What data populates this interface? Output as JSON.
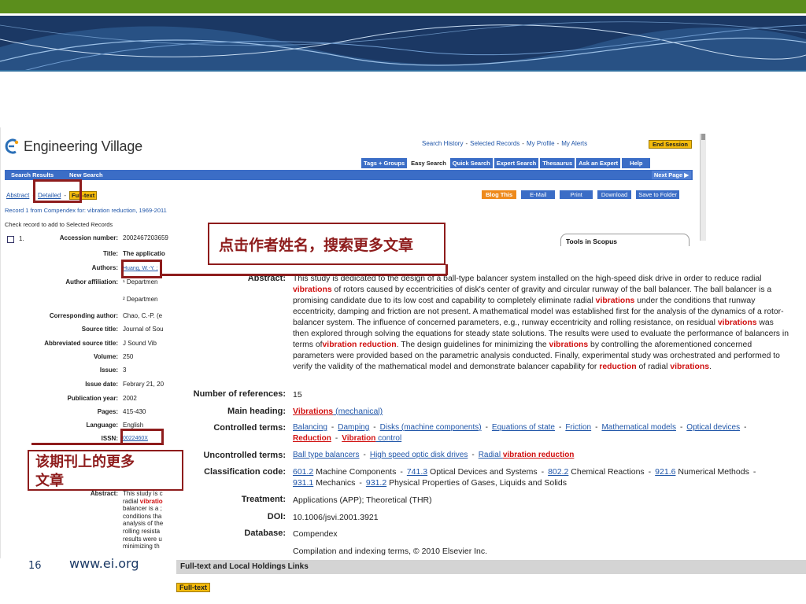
{
  "slide": {
    "page_number": "16",
    "site": "www.ei.org"
  },
  "annotations": {
    "author_tip": "点击作者姓名，搜索更多文章",
    "issn_tip_line1": "该期刊上的更多",
    "issn_tip_line2": "文章"
  },
  "app": {
    "logo_text": "Engineering Village",
    "top_links": [
      "Search History",
      "Selected Records",
      "My Profile",
      "My Alerts"
    ],
    "end_session": "End Session",
    "tabs": [
      "Tags + Groups",
      "Easy Search",
      "Quick Search",
      "Expert Search",
      "Thesaurus",
      "Ask an Expert",
      "Help"
    ],
    "active_tab": "Easy Search",
    "nav": {
      "search_results": "Search Results",
      "new_search": "New Search",
      "next_page": "Next Page ▶"
    },
    "subnav": {
      "abstract": "Abstract",
      "detailed": "Detailed",
      "fulltext": "Full-text"
    },
    "actions": [
      "Blog This",
      "E-Mail",
      "Print",
      "Download",
      "Save to Folder"
    ],
    "record_info": "Record 1 from Compendex for: vibration reduction, 1969-2011",
    "check_info": "Check record to add to Selected Records",
    "record_number": "1.",
    "tools_box": "Tools in Scopus"
  },
  "record_left": {
    "fields": [
      {
        "label": "Accession number:",
        "value": "2002467203659"
      },
      {
        "label": "Title:",
        "value": "The applicatio"
      },
      {
        "label": "Authors:",
        "value": "Huang, W.-Y. ;"
      },
      {
        "label": "Author affiliation:",
        "value": "¹ Departmen"
      },
      {
        "label": "",
        "value": "² Departmen"
      },
      {
        "label": "Corresponding author:",
        "value": "Chao, C.-P. (e"
      },
      {
        "label": "Source title:",
        "value": "Journal of Sou"
      },
      {
        "label": "Abbreviated source title:",
        "value": "J Sound Vib"
      },
      {
        "label": "Volume:",
        "value": "250"
      },
      {
        "label": "Issue:",
        "value": "3"
      },
      {
        "label": "Issue date:",
        "value": "Febrary 21, 20"
      },
      {
        "label": "Publication year:",
        "value": "2002"
      },
      {
        "label": "Pages:",
        "value": "415-430"
      },
      {
        "label": "Language:",
        "value": "English"
      },
      {
        "label": "ISSN:",
        "value": "0022460X"
      },
      {
        "label": "Abstract:",
        "value": ""
      }
    ],
    "abstract_preview": [
      "This study is c",
      "radial ",
      "vibratio",
      "balancer is a ;",
      "conditions tha",
      "analysis of the",
      "rolling resista",
      "results were u",
      "minimizing th"
    ]
  },
  "detail": {
    "labels": {
      "abstract": "Abstract:",
      "num_refs": "Number of references:",
      "main_heading": "Main heading:",
      "controlled": "Controlled terms:",
      "uncontrolled": "Uncontrolled terms:",
      "classification": "Classification code:",
      "treatment": "Treatment:",
      "doi": "DOI:",
      "database": "Database:"
    },
    "abstract_parts": [
      "This study is dedicated to the design of a ball-type balancer system installed on the high-speed disk drive in order to reduce radial ",
      "vibrations",
      " of rotors caused by eccentricities of disk's center of gravity and circular runway of the ball balancer. The ball balancer is a promising candidate due to its low cost and capability to completely eliminate radial ",
      "vibrations",
      " under the conditions that runway eccentricity, damping and friction are not present. A mathematical model was established first for the analysis of the dynamics of a rotor-balancer system. The influence of concerned parameters, e.g., runway eccentricity and rolling resistance, on residual ",
      "vibrations",
      " was then explored through solving the equations for steady state solutions. The results were used to evaluate the performance of balancers in terms of",
      "vibration reduction",
      ". The design guidelines for minimizing the ",
      "vibrations",
      " by controlling the aforementioned concerned parameters were provided based on the parametric analysis conducted. Finally, experimental study was orchestrated and performed to verify the validity of the mathematical model and demonstrate balancer capability for ",
      "reduction",
      " of radial ",
      "vibrations",
      "."
    ],
    "num_refs": "15",
    "main_heading_hl": "Vibrations",
    "main_heading_rest": " (mechanical)",
    "controlled_terms": [
      "Balancing",
      "Damping",
      "Disks (machine components)",
      "Equations of state",
      "Friction",
      "Mathematical models",
      "Optical devices"
    ],
    "controlled_terms_2": {
      "reduction": "Reduction",
      "vibration": "Vibration",
      "control": " control"
    },
    "uncontrolled_terms": {
      "t1": "Ball type balancers",
      "t2": "High speed optic disk drives",
      "t3_pre": "Radial ",
      "t3_hl": "vibration reduction"
    },
    "classification": [
      {
        "code": "601.2",
        "desc": " Machine Components"
      },
      {
        "code": "741.3",
        "desc": " Optical Devices and Systems"
      },
      {
        "code": "802.2",
        "desc": " Chemical Reactions"
      },
      {
        "code": "921.6",
        "desc": " Numerical Methods"
      },
      {
        "code": "931.1",
        "desc": " Mechanics"
      },
      {
        "code": "931.2",
        "desc": " Physical Properties of Gases, Liquids and Solids"
      }
    ],
    "treatment": "Applications (APP); Theoretical (THR)",
    "doi": "10.1006/jsvi.2001.3921",
    "database": "Compendex",
    "copyright": "Compilation and indexing terms, © 2010 Elsevier Inc."
  },
  "links": {
    "header": "Full-text and Local Holdings Links",
    "fulltext": "Full-text"
  }
}
